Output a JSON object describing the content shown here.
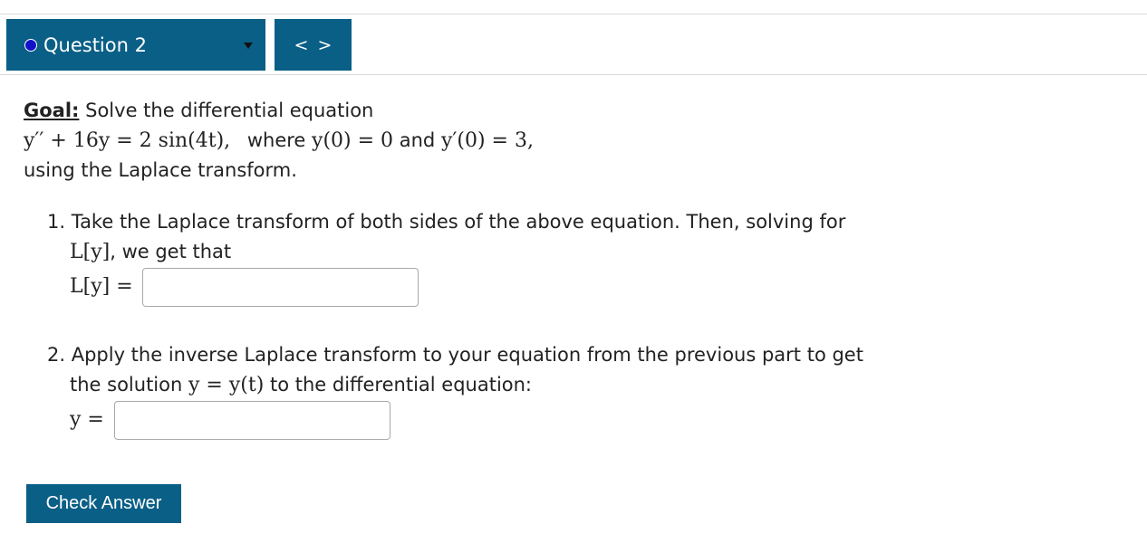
{
  "nav": {
    "question_label": "Question 2",
    "prev": "<",
    "next": ">"
  },
  "goal": {
    "label": "Goal:",
    "intro": "Solve the differential equation",
    "equation_lhs": "y′′ + 16y = 2 sin(4t),",
    "where_text": "where",
    "ic1": "y(0) = 0",
    "and_text": "and",
    "ic2": "y′(0) = 3,",
    "closing": "using the Laplace transform."
  },
  "step1": {
    "line1": "1. Take the Laplace transform of both sides of the above equation. Then, solving for",
    "ly": "L[y]",
    "line2_rest": ", we get that",
    "answer_label": "L[y] =",
    "answer_value": ""
  },
  "step2": {
    "line1": "2. Apply the inverse Laplace transform to your equation from the previous part to get",
    "line2_a": "the solution",
    "line2_math": "y = y(t)",
    "line2_b": "to the differential equation:",
    "answer_label": "y =",
    "answer_value": ""
  },
  "check_button": "Check Answer",
  "colors": {
    "header_bg": "#0a5f86",
    "status_dot": "#1111c8"
  }
}
